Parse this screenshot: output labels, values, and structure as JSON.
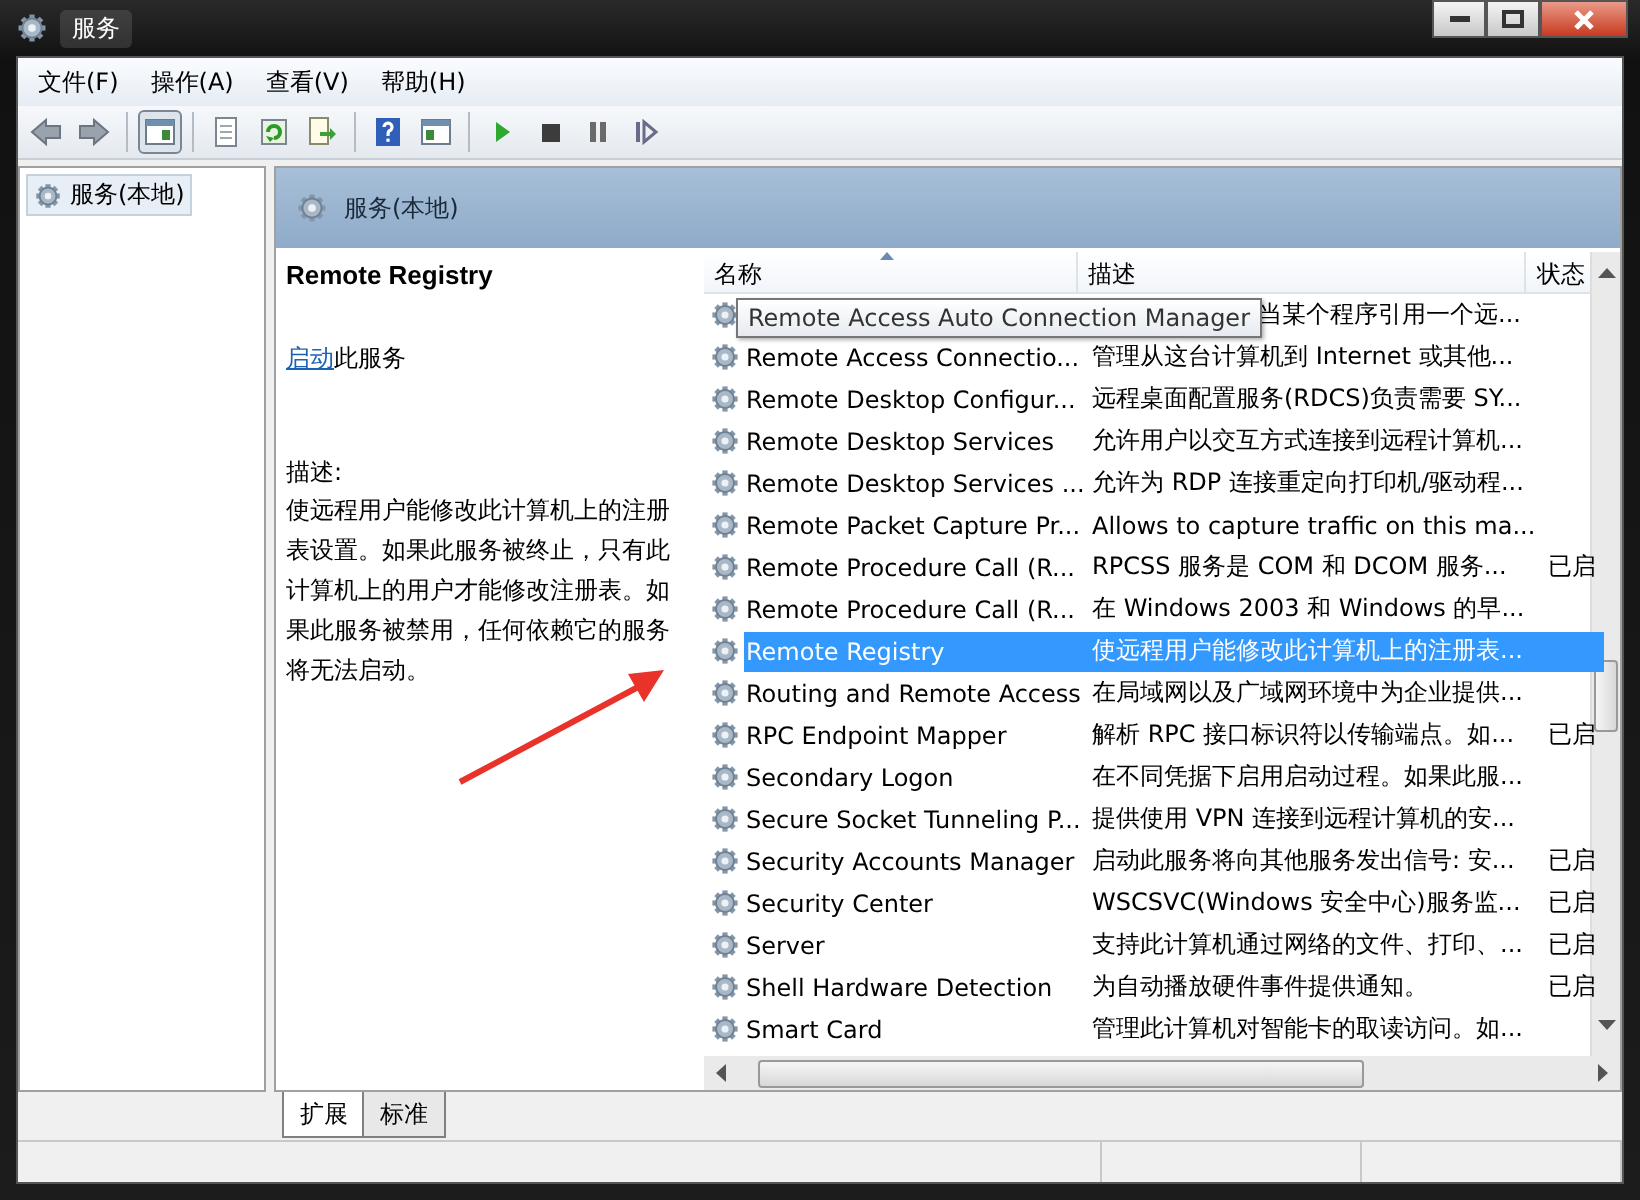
{
  "window": {
    "title": "服务"
  },
  "menu": [
    "文件(F)",
    "操作(A)",
    "查看(V)",
    "帮助(H)"
  ],
  "tree": {
    "items": [
      {
        "label": "服务(本地)",
        "selected": true
      }
    ]
  },
  "panel": {
    "title": "服务(本地)"
  },
  "details": {
    "name": "Remote Registry",
    "link": "启动",
    "link_suffix": "此服务",
    "description_label": "描述:",
    "description": "使远程用户能修改此计算机上的注册表设置。如果此服务被终止，只有此计算机上的用户才能修改注册表。如果此服务被禁用，任何依赖它的服务将无法启动。"
  },
  "table": {
    "columns": [
      {
        "label": "名称",
        "sorted": true
      },
      {
        "label": "描述",
        "sorted": false
      },
      {
        "label": "状态",
        "sorted": false
      }
    ],
    "rows": [
      {
        "description": "当某个程序引用一个远...",
        "selected": false
      },
      {
        "name": "Remote Access Connectio...",
        "description": "管理从这台计算机到 Internet 或其他...",
        "selected": false
      },
      {
        "name": "Remote Desktop Configur...",
        "description": "远程桌面配置服务(RDCS)负责需要 SY...",
        "selected": false
      },
      {
        "name": "Remote Desktop Services",
        "description": "允许用户以交互方式连接到远程计算机...",
        "selected": false
      },
      {
        "name": "Remote Desktop Services ...",
        "description": "允许为 RDP 连接重定向打印机/驱动程...",
        "selected": false
      },
      {
        "name": "Remote Packet Capture Pr...",
        "description": "Allows to capture traffic on this ma...",
        "selected": false
      },
      {
        "name": "Remote Procedure Call (R...",
        "description": "RPCSS 服务是 COM 和 DCOM 服务...",
        "status": "已启",
        "selected": false
      },
      {
        "name": "Remote Procedure Call (R...",
        "description": "在 Windows 2003 和 Windows 的早...",
        "selected": false
      },
      {
        "name": "Remote Registry",
        "description": "使远程用户能修改此计算机上的注册表...",
        "selected": true
      },
      {
        "name": "Routing and Remote Access",
        "description": "在局域网以及广域网环境中为企业提供...",
        "selected": false
      },
      {
        "name": "RPC Endpoint Mapper",
        "description": "解析 RPC 接口标识符以传输端点。如...",
        "status": "已启",
        "selected": false
      },
      {
        "name": "Secondary Logon",
        "description": "在不同凭据下启用启动过程。如果此服...",
        "selected": false
      },
      {
        "name": "Secure Socket Tunneling P...",
        "description": "提供使用 VPN 连接到远程计算机的安...",
        "selected": false
      },
      {
        "name": "Security Accounts Manager",
        "description": "启动此服务将向其他服务发出信号: 安...",
        "status": "已启",
        "selected": false
      },
      {
        "name": "Security Center",
        "description": "WSCSVC(Windows 安全中心)服务监...",
        "status": "已启",
        "selected": false
      },
      {
        "name": "Server",
        "description": "支持此计算机通过网络的文件、打印、...",
        "status": "已启",
        "selected": false
      },
      {
        "name": "Shell Hardware Detection",
        "description": "为自动播放硬件事件提供通知。",
        "status": "已启",
        "selected": false
      },
      {
        "name": "Smart Card",
        "description": "管理此计算机对智能卡的取读访问。如...",
        "selected": false
      }
    ]
  },
  "tooltip": "Remote Access Auto Connection Manager",
  "bottom_tabs": [
    {
      "label": "扩展",
      "selected": true
    },
    {
      "label": "标准",
      "selected": false
    }
  ]
}
